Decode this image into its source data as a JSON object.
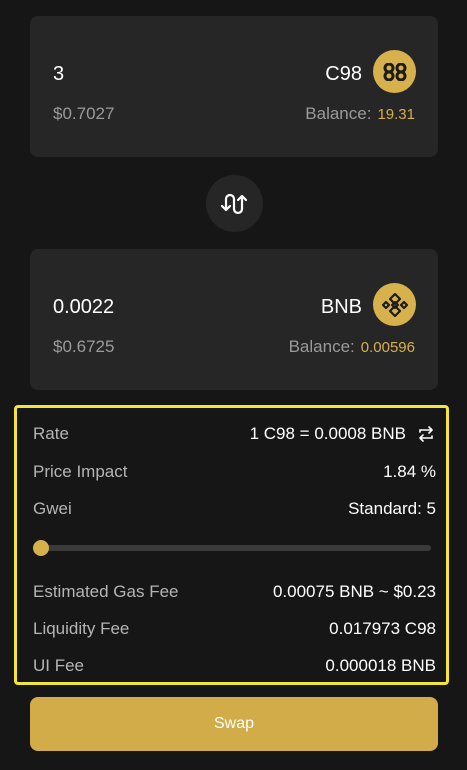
{
  "from": {
    "amount": "3",
    "usd": "$0.7027",
    "token": "C98",
    "balance_label": "Balance:",
    "balance_value": "19.31",
    "icon": "c98-coin-icon"
  },
  "to": {
    "amount": "0.0022",
    "usd": "$0.6725",
    "token": "BNB",
    "balance_label": "Balance:",
    "balance_value": "0.00596",
    "icon": "bnb-coin-icon"
  },
  "details": {
    "rate_label": "Rate",
    "rate_value": "1 C98 = 0.0008 BNB",
    "price_impact_label": "Price Impact",
    "price_impact_value": "1.84 %",
    "gwei_label": "Gwei",
    "gwei_value": "Standard: 5",
    "gwei_slider_level": 0,
    "gas_fee_label": "Estimated Gas Fee",
    "gas_fee_value": "0.00075 BNB ~ $0.23",
    "liquidity_fee_label": "Liquidity Fee",
    "liquidity_fee_value": "0.017973 C98",
    "ui_fee_label": "UI Fee",
    "ui_fee_value": "0.000018 BNB"
  },
  "swap_button_label": "Swap",
  "colors": {
    "background": "#161616",
    "card": "#262626",
    "accent": "#d6b04c",
    "highlight_border": "#f2e63a"
  }
}
